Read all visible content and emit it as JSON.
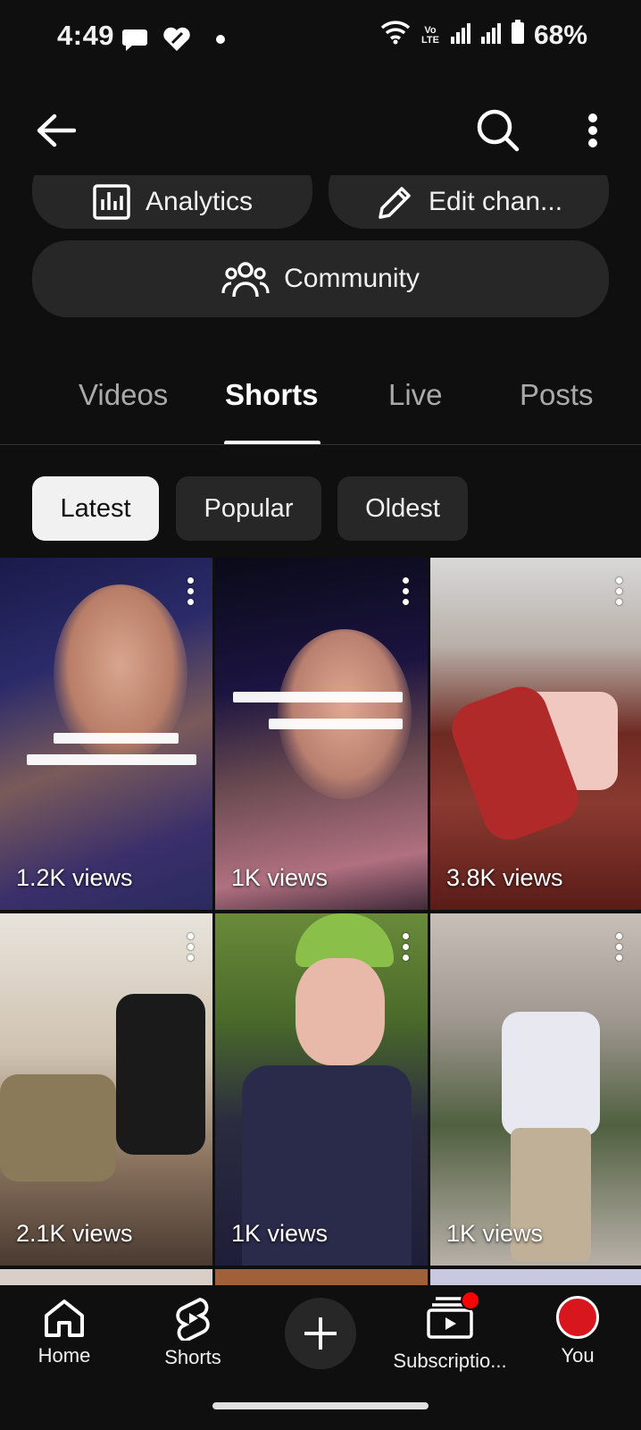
{
  "status": {
    "time": "4:49",
    "network": "Vo LTE",
    "battery": "68%"
  },
  "header": {
    "back_icon": "arrow-left-icon",
    "search_icon": "search-icon",
    "more_icon": "more-vertical-icon"
  },
  "actions": {
    "analytics": "Analytics",
    "edit_channel": "Edit chan...",
    "community": "Community"
  },
  "tabs": [
    {
      "label": "Videos",
      "active": false
    },
    {
      "label": "Shorts",
      "active": true
    },
    {
      "label": "Live",
      "active": false
    },
    {
      "label": "Posts",
      "active": false
    }
  ],
  "chips": [
    {
      "label": "Latest",
      "selected": true
    },
    {
      "label": "Popular",
      "selected": false
    },
    {
      "label": "Oldest",
      "selected": false
    }
  ],
  "shorts": [
    {
      "views": "1.2K views"
    },
    {
      "views": "1K views"
    },
    {
      "views": "3.8K views"
    },
    {
      "views": "2.1K views"
    },
    {
      "views": "1K views"
    },
    {
      "views": "1K views"
    }
  ],
  "nav": {
    "home": "Home",
    "shorts": "Shorts",
    "create_icon": "plus-icon",
    "subscriptions": "Subscriptio...",
    "you": "You"
  },
  "colors": {
    "background": "#0f0f0f",
    "surface": "#272727",
    "accent": "#ff0000"
  }
}
